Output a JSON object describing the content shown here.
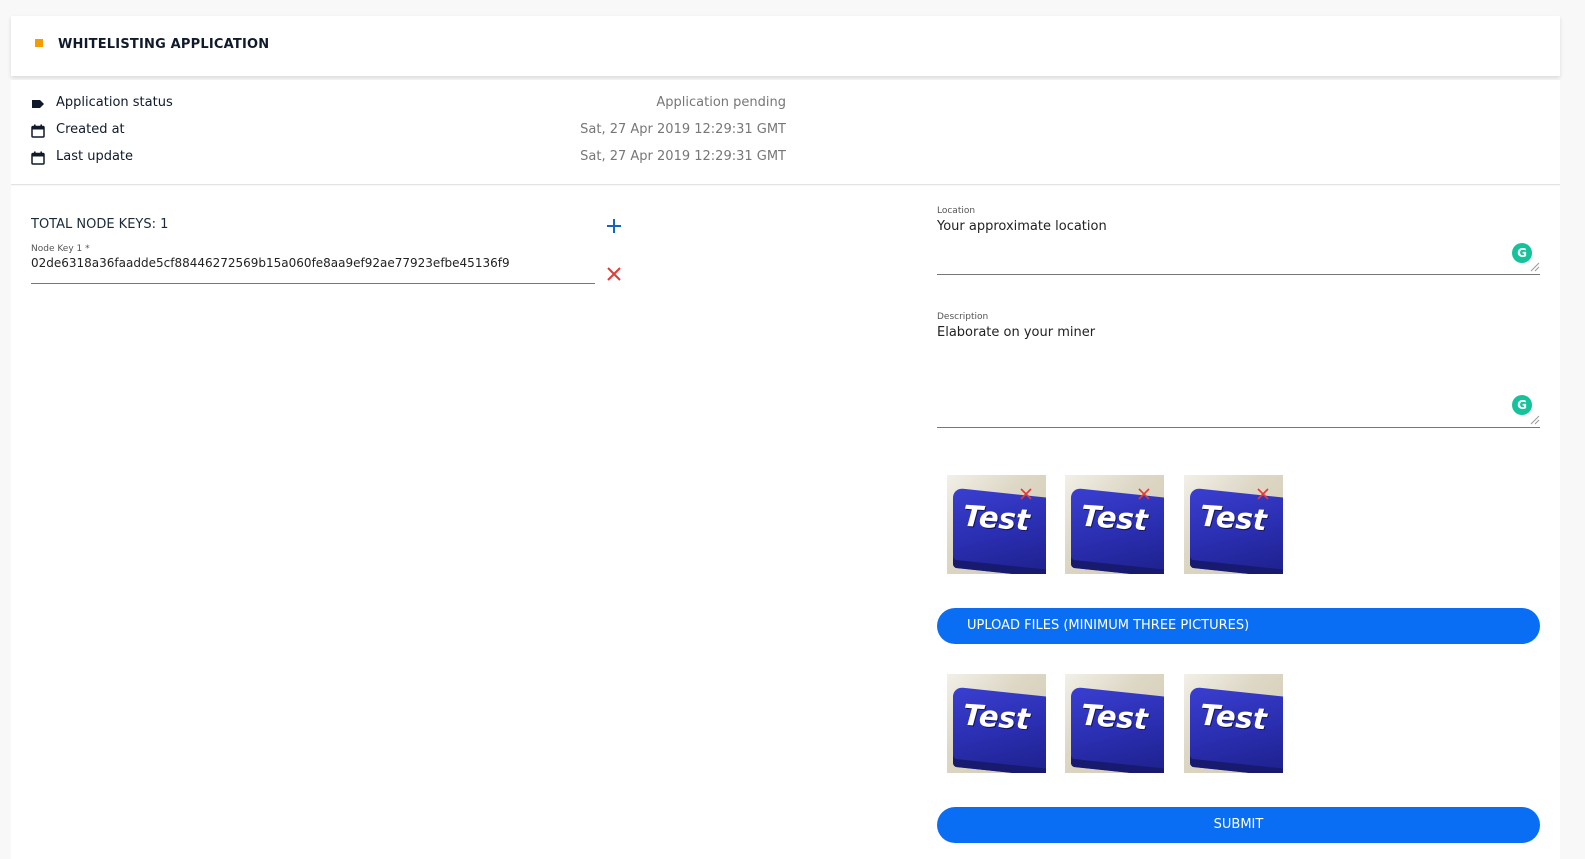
{
  "header": {
    "title": "WHITELISTING APPLICATION",
    "accent_color": "#f59c00"
  },
  "info": {
    "rows": [
      {
        "icon": "tag-icon",
        "label": "Application status",
        "value": "Application pending"
      },
      {
        "icon": "calendar-icon",
        "label": "Created at",
        "value": "Sat, 27 Apr 2019 12:29:31 GMT"
      },
      {
        "icon": "calendar-icon",
        "label": "Last update",
        "value": "Sat, 27 Apr 2019 12:29:31 GMT"
      }
    ]
  },
  "nodes": {
    "total_label": "TOTAL NODE KEYS: 1",
    "add_icon": "plus-icon",
    "remove_icon": "close-icon",
    "keys": [
      {
        "label": "Node Key 1 *",
        "value": "02de6318a36faadde5cf88446272569b15a060fe8aa9ef92ae77923efbe45136f9"
      }
    ]
  },
  "form": {
    "location": {
      "label": "Location",
      "placeholder": "Your approximate location"
    },
    "description": {
      "label": "Description",
      "placeholder": "Elaborate on your miner"
    },
    "grammarly_icon": "grammarly-icon",
    "assistant_letter": "G"
  },
  "uploaded_images": {
    "text": [
      "Test",
      "Test",
      "Test"
    ]
  },
  "preview_images": {
    "text": [
      "Test",
      "Test",
      "Test"
    ]
  },
  "buttons": {
    "upload_label": "UPLOAD FILES (MINIMUM THREE PICTURES)",
    "submit_label": "SUBMIT",
    "primary_color": "#0a6ef5"
  }
}
